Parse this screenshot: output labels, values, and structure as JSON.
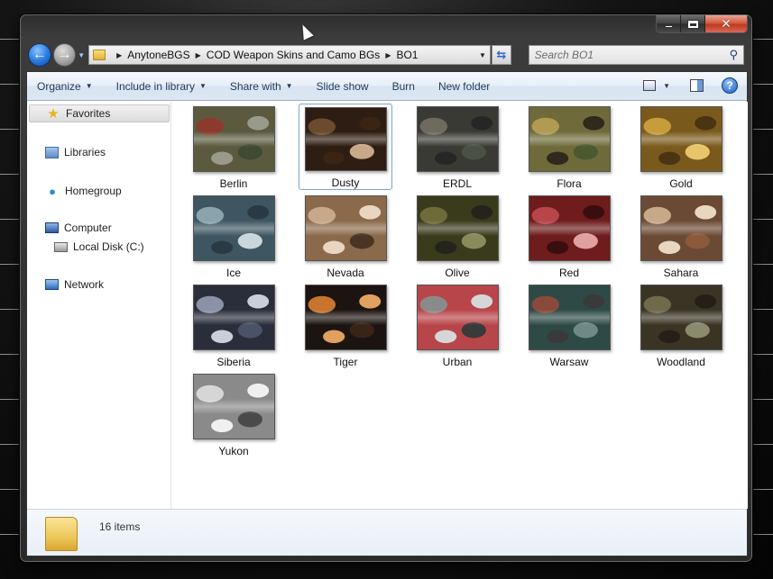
{
  "window": {
    "caption_buttons": {
      "minimize": "–",
      "maximize": "□",
      "close": "✕"
    }
  },
  "navigation": {
    "back_icon": "back-arrow-icon",
    "forward_icon": "forward-arrow-icon",
    "breadcrumb": [
      "AnytoneBGS",
      "COD Weapon Skins and Camo BGs",
      "BO1"
    ],
    "search_placeholder": "Search BO1"
  },
  "command_bar": {
    "organize": "Organize",
    "include_in_library": "Include in library",
    "share_with": "Share with",
    "slide_show": "Slide show",
    "burn": "Burn",
    "new_folder": "New folder",
    "help": "?"
  },
  "nav_pane": {
    "favorites": "Favorites",
    "libraries": "Libraries",
    "homegroup": "Homegroup",
    "computer": "Computer",
    "local_disk": "Local Disk (C:)",
    "network": "Network"
  },
  "files": [
    {
      "name": "Berlin",
      "colors": [
        "#5b5a3f",
        "#8c3a2e",
        "#3e4a32",
        "#9a9a8a"
      ]
    },
    {
      "name": "Dusty",
      "colors": [
        "#2e1d12",
        "#6b4a2e",
        "#c7a98a",
        "#3a2414"
      ]
    },
    {
      "name": "ERDL",
      "colors": [
        "#3a3a34",
        "#6e6a5e",
        "#4a5044",
        "#262626"
      ]
    },
    {
      "name": "Flora",
      "colors": [
        "#6e6a3a",
        "#b19a52",
        "#4a5a2e",
        "#2e2a1c"
      ]
    },
    {
      "name": "Gold",
      "colors": [
        "#7a5a1c",
        "#c79c3a",
        "#e8c46a",
        "#4a3412"
      ]
    },
    {
      "name": "Ice",
      "colors": [
        "#3e5662",
        "#8aa4ae",
        "#c9d6da",
        "#2a3a44"
      ]
    },
    {
      "name": "Nevada",
      "colors": [
        "#8a6a4a",
        "#c7a98a",
        "#4a3424",
        "#e8d6c0"
      ]
    },
    {
      "name": "Olive",
      "colors": [
        "#3a3a1c",
        "#6e6a3a",
        "#8a8a5a",
        "#24241a"
      ]
    },
    {
      "name": "Red",
      "colors": [
        "#6e1c1c",
        "#b8454a",
        "#e0a0a0",
        "#3a0e0e"
      ]
    },
    {
      "name": "Sahara",
      "colors": [
        "#6a4a34",
        "#c7a98a",
        "#8a5a3a",
        "#e8d6c0"
      ]
    },
    {
      "name": "Siberia",
      "colors": [
        "#2a2e3a",
        "#8a92a8",
        "#4a5268",
        "#c9ced8"
      ]
    },
    {
      "name": "Tiger",
      "colors": [
        "#1c1410",
        "#c7742e",
        "#3a2418",
        "#e0a060"
      ]
    },
    {
      "name": "Urban",
      "colors": [
        "#b8454a",
        "#8a8a8a",
        "#3a3a3a",
        "#d6d6d6"
      ]
    },
    {
      "name": "Warsaw",
      "colors": [
        "#2e4a46",
        "#8a4a3a",
        "#6e8a86",
        "#3a3a3a"
      ]
    },
    {
      "name": "Woodland",
      "colors": [
        "#3a3424",
        "#6e6a4a",
        "#8a8a6e",
        "#242018"
      ]
    },
    {
      "name": "Yukon",
      "colors": [
        "#8a8a8a",
        "#d6d6d6",
        "#4a4a4a",
        "#f0f0f0"
      ]
    }
  ],
  "selected_file": "Dusty",
  "status": {
    "item_count": "16 items"
  }
}
